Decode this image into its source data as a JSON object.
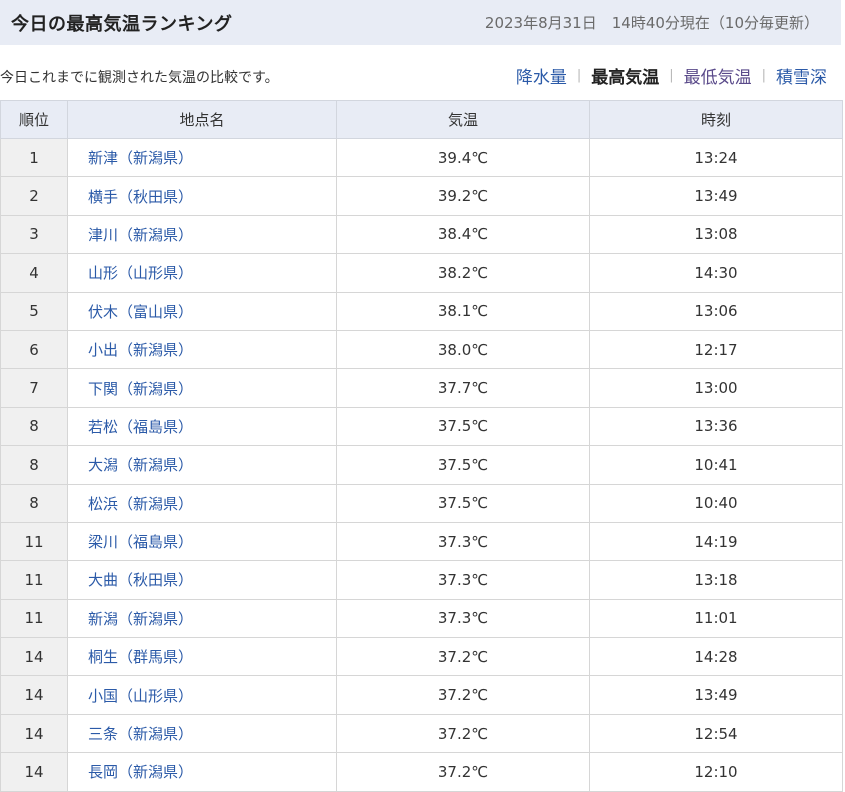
{
  "header": {
    "title": "今日の最高気温ランキング",
    "timestamp": "2023年8月31日　14時40分現在（10分毎更新）"
  },
  "description": "今日これまでに観測された気温の比較です。",
  "tabs": [
    {
      "label": "降水量",
      "active": false
    },
    {
      "label": "最高気温",
      "active": true
    },
    {
      "label": "最低気温",
      "active": false
    },
    {
      "label": "積雪深",
      "active": false
    }
  ],
  "table": {
    "columns": [
      "順位",
      "地点名",
      "気温",
      "時刻"
    ],
    "rows": [
      {
        "rank": "1",
        "location": "新津（新潟県）",
        "temp": "39.4℃",
        "time": "13:24"
      },
      {
        "rank": "2",
        "location": "横手（秋田県）",
        "temp": "39.2℃",
        "time": "13:49"
      },
      {
        "rank": "3",
        "location": "津川（新潟県）",
        "temp": "38.4℃",
        "time": "13:08"
      },
      {
        "rank": "4",
        "location": "山形（山形県）",
        "temp": "38.2℃",
        "time": "14:30"
      },
      {
        "rank": "5",
        "location": "伏木（富山県）",
        "temp": "38.1℃",
        "time": "13:06"
      },
      {
        "rank": "6",
        "location": "小出（新潟県）",
        "temp": "38.0℃",
        "time": "12:17"
      },
      {
        "rank": "7",
        "location": "下関（新潟県）",
        "temp": "37.7℃",
        "time": "13:00"
      },
      {
        "rank": "8",
        "location": "若松（福島県）",
        "temp": "37.5℃",
        "time": "13:36"
      },
      {
        "rank": "8",
        "location": "大潟（新潟県）",
        "temp": "37.5℃",
        "time": "10:41"
      },
      {
        "rank": "8",
        "location": "松浜（新潟県）",
        "temp": "37.5℃",
        "time": "10:40"
      },
      {
        "rank": "11",
        "location": "梁川（福島県）",
        "temp": "37.3℃",
        "time": "14:19"
      },
      {
        "rank": "11",
        "location": "大曲（秋田県）",
        "temp": "37.3℃",
        "time": "13:18"
      },
      {
        "rank": "11",
        "location": "新潟（新潟県）",
        "temp": "37.3℃",
        "time": "11:01"
      },
      {
        "rank": "14",
        "location": "桐生（群馬県）",
        "temp": "37.2℃",
        "time": "14:28"
      },
      {
        "rank": "14",
        "location": "小国（山形県）",
        "temp": "37.2℃",
        "time": "13:49"
      },
      {
        "rank": "14",
        "location": "三条（新潟県）",
        "temp": "37.2℃",
        "time": "12:54"
      },
      {
        "rank": "14",
        "location": "長岡（新潟県）",
        "temp": "37.2℃",
        "time": "12:10"
      }
    ]
  }
}
